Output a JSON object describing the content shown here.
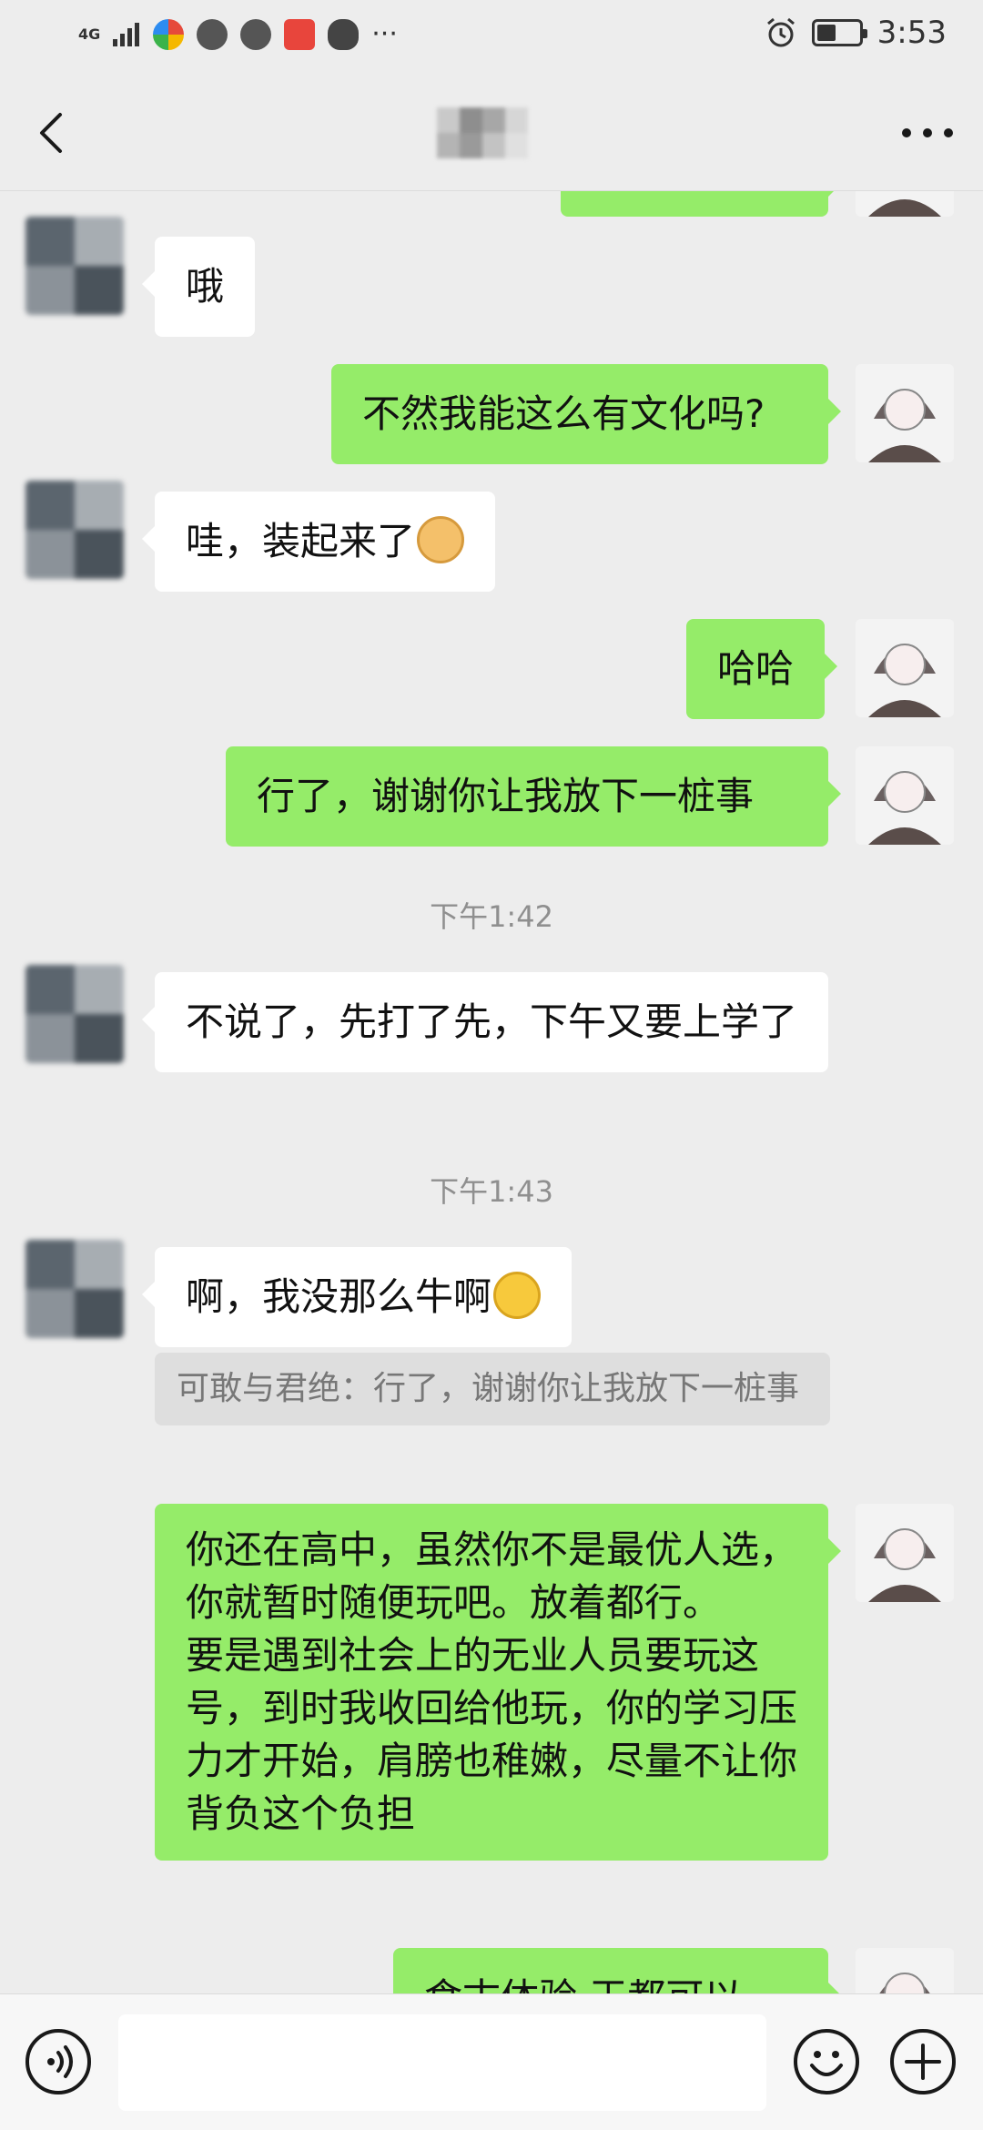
{
  "status_bar": {
    "network": "4G",
    "time": "3:53",
    "battery_level": 0.4,
    "more_indicator": "···"
  },
  "nav": {
    "back_icon": "chevron-left-icon",
    "more_icon": "more-dots-icon"
  },
  "messages": [
    {
      "side": "in",
      "text": "哦"
    },
    {
      "side": "out",
      "text": "不然我能这么有文化吗?"
    },
    {
      "side": "in",
      "text": "哇，装起来了"
    },
    {
      "side": "out",
      "text": "哈哈"
    },
    {
      "side": "out",
      "text": "行了，谢谢你让我放下一桩事"
    },
    {
      "side": "in",
      "text": "不说了，先打了先，下午又要上学了"
    },
    {
      "side": "in",
      "text": "啊，我没那么牛啊"
    },
    {
      "side": "out",
      "text": "你还在高中，虽然你不是最优人选，你就暂时随便玩吧。放着都行。\n要是遇到社会上的无业人员要玩这号，到时我收回给他玩，你的学习压力才开始，肩膀也稚嫩，尽量不让你背负这个负担"
    },
    {
      "side": "out",
      "text": "食古体验 王都可以"
    }
  ],
  "timestamps": [
    "下午1:42",
    "下午1:43"
  ],
  "quote": {
    "text": "可敢与君绝：行了，谢谢你让我放下一桩事"
  },
  "input": {
    "placeholder": ""
  },
  "colors": {
    "out_bubble": "#95ec69",
    "in_bubble": "#ffffff",
    "background": "#ededed"
  }
}
